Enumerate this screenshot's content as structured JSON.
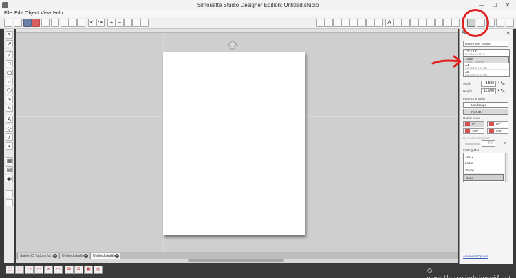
{
  "window": {
    "title": "Silhouette Studio Designer Edition: Untitled.studio",
    "controls": {
      "minimize": "—",
      "maximize": "☐",
      "close": "✕"
    }
  },
  "menu": [
    "File",
    "Edit",
    "Object",
    "View",
    "Help"
  ],
  "toolbar": {
    "icons": [
      "new-icon",
      "open-icon",
      "save-icon",
      "save-as-icon",
      "print-icon",
      "send-to-silhouette-icon",
      "cut-icon",
      "copy-icon",
      "paste-icon",
      "undo-icon",
      "redo-icon",
      "zoom-in-icon",
      "zoom-out-icon",
      "zoom-box-icon",
      "pan-icon",
      "fit-page-icon"
    ],
    "right_icons": [
      "page-settings-icon",
      "cut-settings-icon",
      "registration-icon"
    ]
  },
  "left_tools": [
    "select-icon",
    "point-edit-icon",
    "line-icon",
    "rectangle-icon",
    "rounded-rect-icon",
    "ellipse-icon",
    "polygon-icon",
    "curve-icon",
    "freehand-icon",
    "text-icon",
    "eraser-icon",
    "knife-icon",
    "fill-icon",
    "library-icon",
    "store-icon",
    "online-icon"
  ],
  "document_tabs": [
    {
      "label": "Safety ID Tattoos for ...",
      "active": false
    },
    {
      "label": "Untitled.studio",
      "active": false
    },
    {
      "label": "Untitled.studio",
      "active": true
    }
  ],
  "panel": {
    "title": "Pa",
    "use_printer_setting": "Use Printer Setting",
    "page_sizes": [
      {
        "name": "12\" x 12\"",
        "sub": "12.000 x 12.000 in",
        "selected": false
      },
      {
        "name": "Letter",
        "sub": "8.500 x 11.000 in",
        "selected": true
      },
      {
        "name": "A4",
        "sub": "210.00 x 297.00 mm",
        "selected": false
      },
      {
        "name": "A5",
        "sub": "148.00 x 210.00 mm",
        "selected": false
      }
    ],
    "width_label": "Width",
    "width_value": "8.500",
    "width_unit": "in",
    "height_label": "Height",
    "height_value": "11.000",
    "height_unit": "in",
    "orientation_label": "Page Orientation",
    "landscape": "Landscape",
    "portrait": "Portrait",
    "rotate_label": "Rotate View",
    "rot_0": "0°",
    "rot_90": "90°",
    "rot_180": "180°",
    "rot_270": "270°",
    "reveal_label": "Reveal Cutting Mat",
    "reveal_value": "0%",
    "reveal_unit": "%",
    "mat_label": "Cutting Mat",
    "mats": [
      {
        "name": "12x12",
        "selected": false
      },
      {
        "name": "Letter",
        "selected": false
      },
      {
        "name": "Stamp",
        "selected": false
      },
      {
        "name": "None",
        "selected": true
      }
    ],
    "advanced": "Advanced Options"
  },
  "watermark": "© www.thatswhatchesaid.net",
  "colors": {
    "cut_line": "#f08080",
    "annotation": "#e02020",
    "link": "#3a62b8"
  }
}
